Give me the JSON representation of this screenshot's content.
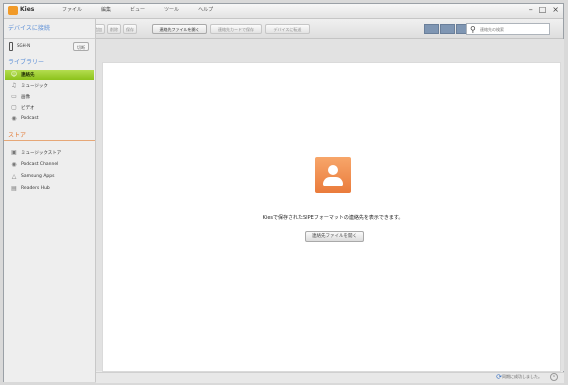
{
  "app": {
    "name": "Kies",
    "brand_color": "#f19a28"
  },
  "menu": [
    "ファイル",
    "編集",
    "ビュー",
    "ツール",
    "ヘルプ"
  ],
  "window_controls": {
    "minimize": "–",
    "maximize": "□",
    "close": "×"
  },
  "toolbar": {
    "buttons": [
      {
        "label": "追加",
        "enabled": false
      },
      {
        "label": "削除",
        "enabled": false
      },
      {
        "label": "保存",
        "enabled": false
      },
      {
        "label": "連絡先ファイルを開く",
        "enabled": true
      },
      {
        "label": "連絡先カードで保存",
        "enabled": false
      },
      {
        "label": "デバイスに転送",
        "enabled": false
      }
    ],
    "search_placeholder": "連絡先の検索"
  },
  "sidebar": {
    "devices_heading": "デバイスに接続",
    "device_label": "SGH-N",
    "device_button": "切断",
    "library_heading": "ライブラリー",
    "library_items": [
      {
        "label": "連絡先",
        "icon": "contacts-icon",
        "selected": true
      },
      {
        "label": "ミュージック",
        "icon": "music-icon",
        "selected": false
      },
      {
        "label": "画像",
        "icon": "image-icon",
        "selected": false
      },
      {
        "label": "ビデオ",
        "icon": "video-icon",
        "selected": false
      },
      {
        "label": "Podcast",
        "icon": "podcast-icon",
        "selected": false
      }
    ],
    "store_heading": "ストア",
    "store_items": [
      {
        "label": "ミュージックストア",
        "icon": "music-store-icon"
      },
      {
        "label": "Podcast Channel",
        "icon": "podcast-channel-icon"
      },
      {
        "label": "Samsung Apps",
        "icon": "samsung-apps-icon"
      },
      {
        "label": "Readers Hub",
        "icon": "readers-hub-icon"
      }
    ]
  },
  "main": {
    "message": "Kiesで保存されたSIPEフォーマットの連絡先を表示できます。",
    "open_button": "連絡先ファイルを開く"
  },
  "status": {
    "sync_text": "同期に成功しました。"
  }
}
